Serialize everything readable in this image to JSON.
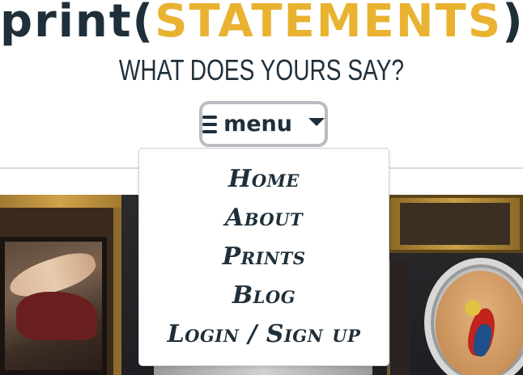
{
  "logo": {
    "part1": "print(",
    "part2": "STATEMENTS",
    "part3": ")"
  },
  "tagline": "WHAT DOES YOURS SAY?",
  "menu_toggle": {
    "label": "menu",
    "icon": "hamburger-icon",
    "caret_icon": "caret-down-icon"
  },
  "dropdown": {
    "items": [
      {
        "label": "Home"
      },
      {
        "label": "About"
      },
      {
        "label": "Prints"
      },
      {
        "label": "Blog"
      },
      {
        "label": "Login / Sign up"
      }
    ]
  },
  "colors": {
    "brand_dark": "#1f2f3a",
    "brand_gold": "#e9b230",
    "menu_border": "#b9bcc1"
  }
}
